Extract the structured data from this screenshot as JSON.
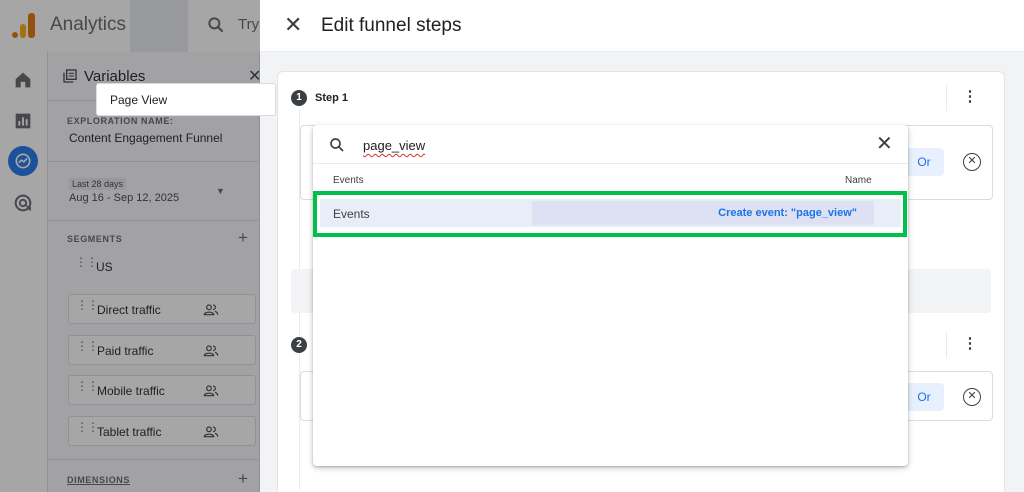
{
  "app": {
    "title": "Analytics",
    "search_placeholder": "Try"
  },
  "variables": {
    "title": "Variables",
    "exploration_label": "EXPLORATION NAME:",
    "exploration_name": "Content Engagement Funnel",
    "date_chip": "Last 28 days",
    "date_range": "Aug 16 - Sep 12, 2025",
    "segments_label": "SEGMENTS",
    "segments": [
      {
        "label": "US"
      },
      {
        "label": "Direct traffic"
      },
      {
        "label": "Paid traffic"
      },
      {
        "label": "Mobile traffic"
      },
      {
        "label": "Tablet traffic"
      }
    ],
    "dimensions_label": "DIMENSIONS"
  },
  "drawer": {
    "title": "Edit funnel steps",
    "step1": {
      "number": "1",
      "label": "Step 1",
      "name": "Page View",
      "or_label": "Or"
    },
    "step2": {
      "number": "2",
      "or_label": "Or"
    }
  },
  "dropdown": {
    "query": "page_view",
    "col_events": "Events",
    "col_name": "Name",
    "row_label": "Events",
    "create_label": "Create event: \"page_view\""
  },
  "colors": {
    "accent": "#1a73e8",
    "highlight": "#00c04b",
    "logo_orange": "#e37400",
    "logo_yellow": "#f9ab00"
  }
}
